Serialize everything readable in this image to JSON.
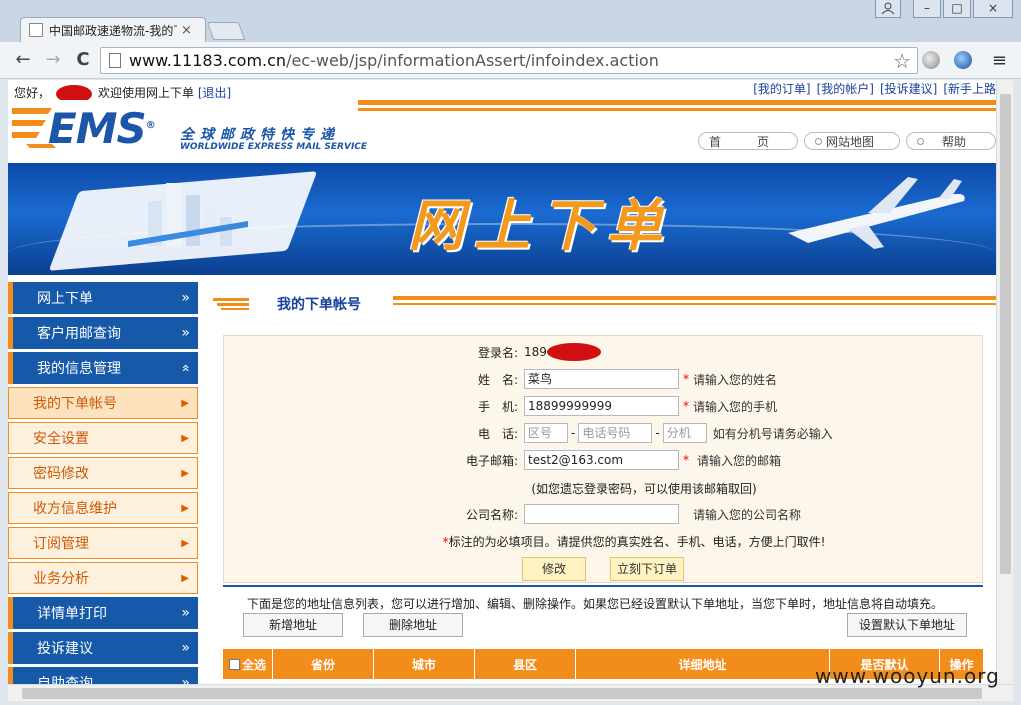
{
  "browser": {
    "tab_title": "中国邮政速递物流-我的下",
    "tab_close": "×",
    "url_host": "www.11183.com.cn",
    "url_path": "/ec-web/jsp/informationAssert/infoindex.action",
    "back": "←",
    "forward": "→",
    "reload": "C",
    "star": "☆",
    "menu": "≡",
    "win_minimize": "–",
    "win_restore": "□",
    "win_close": "×"
  },
  "topbar": {
    "greeting": "您好，",
    "welcome": "欢迎使用网上下单",
    "logout": "[退出]",
    "links": [
      "[我的订单]",
      "[我的帐户]",
      "[投诉建议]",
      "[新手上路"
    ]
  },
  "logo": {
    "ems": "EMS",
    "reg": "®",
    "cn": "全球邮政特快专递",
    "en": "WORLDWIDE EXPRESS MAIL SERVICE"
  },
  "topnav": [
    "首　　　页",
    "网站地图",
    "帮助"
  ],
  "banner": {
    "title": "网上下单"
  },
  "sidebar": {
    "items": [
      {
        "label": "网上下单",
        "arrow": "»"
      },
      {
        "label": "客户用邮查询",
        "arrow": "»"
      },
      {
        "label": "我的信息管理",
        "arrow": "«"
      },
      {
        "label": "我的下单帐号",
        "arrow": "▶"
      },
      {
        "label": "安全设置",
        "arrow": "▶"
      },
      {
        "label": "密码修改",
        "arrow": "▶"
      },
      {
        "label": "收方信息维护",
        "arrow": "▶"
      },
      {
        "label": "订阅管理",
        "arrow": "▶"
      },
      {
        "label": "业务分析",
        "arrow": "▶"
      },
      {
        "label": "详情单打印",
        "arrow": "»"
      },
      {
        "label": "投诉建议",
        "arrow": "»"
      },
      {
        "label": "自助查询",
        "arrow": "»"
      }
    ]
  },
  "main": {
    "title": "我的下单帐号",
    "form": {
      "login_label": "登录名:",
      "login_value": "189",
      "name_label": "姓　名:",
      "name_value": "菜鸟",
      "name_hint": "请输入您的姓名",
      "mobile_label": "手　机:",
      "mobile_value": "18899999999",
      "mobile_hint": "请输入您的手机",
      "phone_label": "电　话:",
      "phone_area_ph": "区号",
      "phone_num_ph": "电话号码",
      "phone_ext_ph": "分机",
      "phone_sep": "-",
      "phone_hint": "如有分机号请务必输入",
      "email_label": "电子邮箱:",
      "email_value": "test2@163.com",
      "email_hint": "请输入您的邮箱",
      "email_note": "(如您遗忘登录密码，可以使用该邮箱取回)",
      "company_label": "公司名称:",
      "company_value": "",
      "company_hint": "请输入您的公司名称",
      "required_mark": "*",
      "required_note": "标注的为必填项目。请提供您的真实姓名、手机、电话，方便上门取件!",
      "modify_button": "修改",
      "order_button": "立刻下订单"
    },
    "address": {
      "note": "下面是您的地址信息列表，您可以进行增加、编辑、删除操作。如果您已经设置默认下单地址，当您下单时，地址信息将自动填充。",
      "add_button": "新增地址",
      "delete_button": "删除地址",
      "default_button": "设置默认下单地址",
      "columns": [
        "全选",
        "省份",
        "城市",
        "县区",
        "详细地址",
        "是否默认",
        "操作"
      ]
    }
  },
  "watermark": "www.wooyun.org",
  "colors": {
    "orange": "#f28c1a",
    "blue": "#1559a8",
    "ems_blue": "#1c56a8"
  }
}
